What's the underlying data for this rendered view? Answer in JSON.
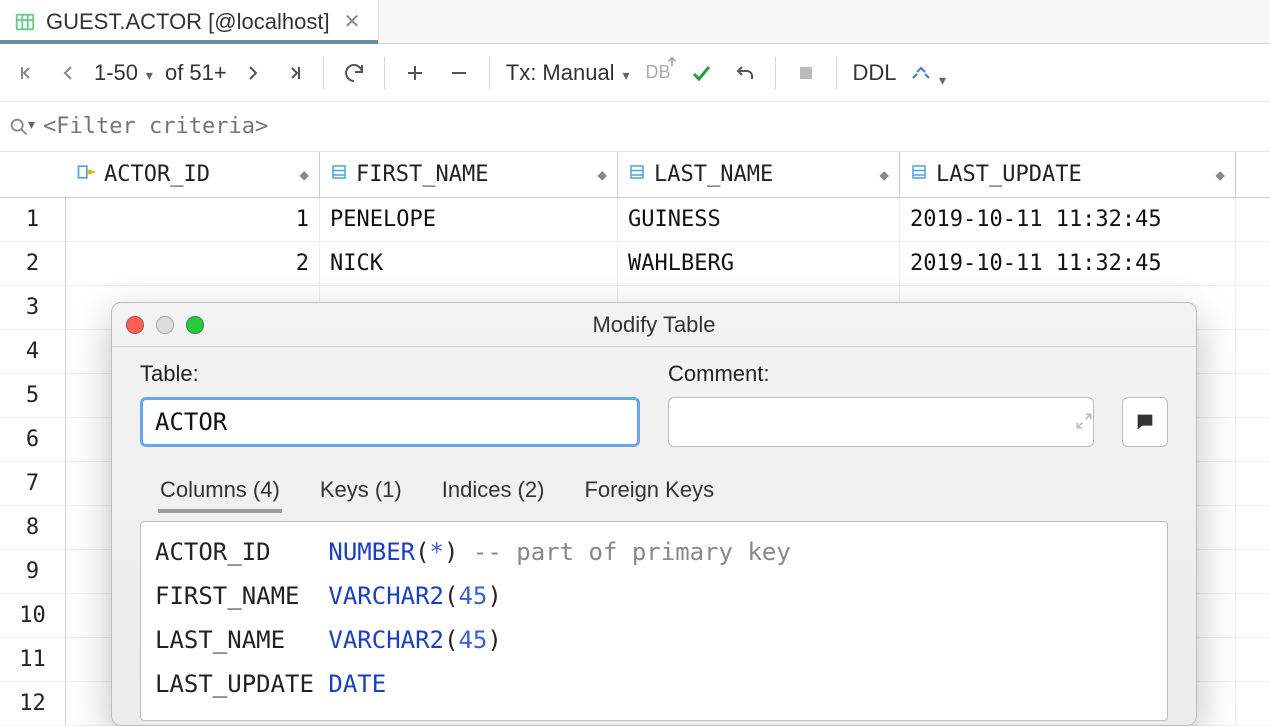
{
  "tab": {
    "title": "GUEST.ACTOR [@localhost]"
  },
  "toolbar": {
    "page_range": "1-50",
    "page_total": "of 51+",
    "tx_label": "Tx: Manual",
    "db_label": "DB",
    "ddl_label": "DDL"
  },
  "filter": {
    "placeholder": "<Filter criteria>"
  },
  "columns": [
    {
      "name": "ACTOR_ID",
      "key": true
    },
    {
      "name": "FIRST_NAME",
      "key": false
    },
    {
      "name": "LAST_NAME",
      "key": false
    },
    {
      "name": "LAST_UPDATE",
      "key": false
    }
  ],
  "rows": [
    {
      "id": "1",
      "first": "PENELOPE",
      "last": "GUINESS",
      "updated": "2019-10-11 11:32:45"
    },
    {
      "id": "2",
      "first": "NICK",
      "last": "WAHLBERG",
      "updated": "2019-10-11 11:32:45"
    }
  ],
  "row_numbers": [
    "1",
    "2",
    "3",
    "4",
    "5",
    "6",
    "7",
    "8",
    "9",
    "10",
    "11",
    "12"
  ],
  "dialog": {
    "title": "Modify Table",
    "table_label": "Table:",
    "comment_label": "Comment:",
    "table_value": "ACTOR",
    "comment_value": "",
    "tabs": [
      {
        "label": "Columns (4)"
      },
      {
        "label": "Keys (1)"
      },
      {
        "label": "Indices (2)"
      },
      {
        "label": "Foreign Keys"
      }
    ],
    "schema": [
      {
        "name": "ACTOR_ID",
        "type": "NUMBER",
        "arg": "*",
        "comment": "-- part of primary key"
      },
      {
        "name": "FIRST_NAME",
        "type": "VARCHAR2",
        "arg": "45",
        "comment": ""
      },
      {
        "name": "LAST_NAME",
        "type": "VARCHAR2",
        "arg": "45",
        "comment": ""
      },
      {
        "name": "LAST_UPDATE",
        "type": "DATE",
        "arg": "",
        "comment": ""
      }
    ]
  }
}
